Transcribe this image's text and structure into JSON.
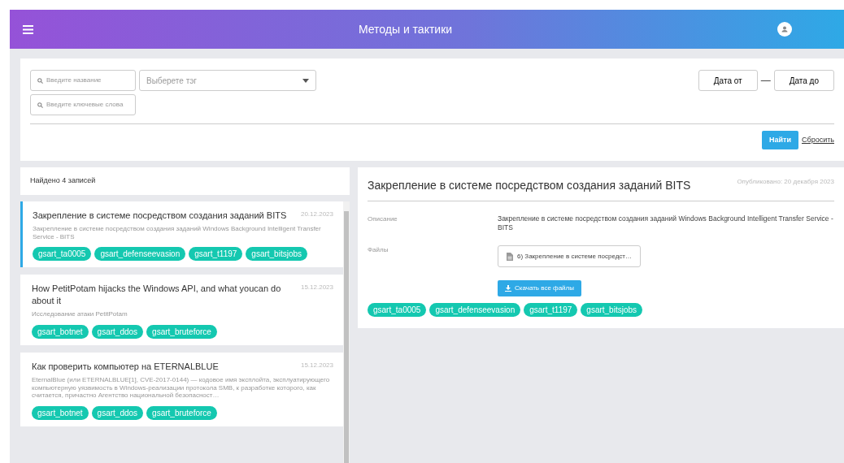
{
  "header": {
    "title": "Методы и тактики"
  },
  "filters": {
    "name_placeholder": "Введите название",
    "tag_placeholder": "Выберете тэг",
    "keywords_placeholder": "Введите ключевые слова",
    "date_from": "Дата от",
    "date_separator": "—",
    "date_to": "Дата до",
    "search_button": "Найти",
    "reset_link": "Сбросить"
  },
  "results": {
    "count_text": "Найдено 4 записей",
    "items": [
      {
        "title": "Закрепление в системе посредством создания заданий BITS",
        "date": "20.12.2023",
        "summary": "Закрепление в системе посредством создания заданий Windows Background Intelligent Transfer Service - BITS",
        "tags": [
          "gsart_ta0005",
          "gsart_defenseevasion",
          "gsart_t1197",
          "gsart_bitsjobs"
        ],
        "selected": true
      },
      {
        "title": "How PetitPotam hijacks the Windows API, and what youcan do about it",
        "date": "15.12.2023",
        "summary": "Исследование атаки PetitPotam",
        "tags": [
          "gsart_botnet",
          "gsart_ddos",
          "gsart_bruteforce"
        ],
        "selected": false
      },
      {
        "title": "Как проверить компьютер на ETERNALBLUE",
        "date": "15.12.2023",
        "summary": "EternalBlue (или ETERNALBLUE[1], CVE-2017-0144) — кодовое имя эксплойта, эксплуатирующего компьютерную уязвимость в Windows-реализации протокола SMB, к разработке которого, как считается, причастно Агентство национальной безопасност…",
        "tags": [
          "gsart_botnet",
          "gsart_ddos",
          "gsart_bruteforce"
        ],
        "selected": false
      }
    ]
  },
  "detail": {
    "title": "Закрепление в системе посредством создания заданий BITS",
    "published": "Опубликовано: 20 декабря 2023",
    "description_label": "Описание",
    "description": "Закрепление в системе посредством создания заданий Windows Background Intelligent Transfer Service - BITS",
    "files_label": "Файлы",
    "files": [
      "6) Закрепление в системе посредст…"
    ],
    "download_button": "Скачать все файлы",
    "tags": [
      "gsart_ta0005",
      "gsart_defenseevasion",
      "gsart_t1197",
      "gsart_bitsjobs"
    ]
  }
}
